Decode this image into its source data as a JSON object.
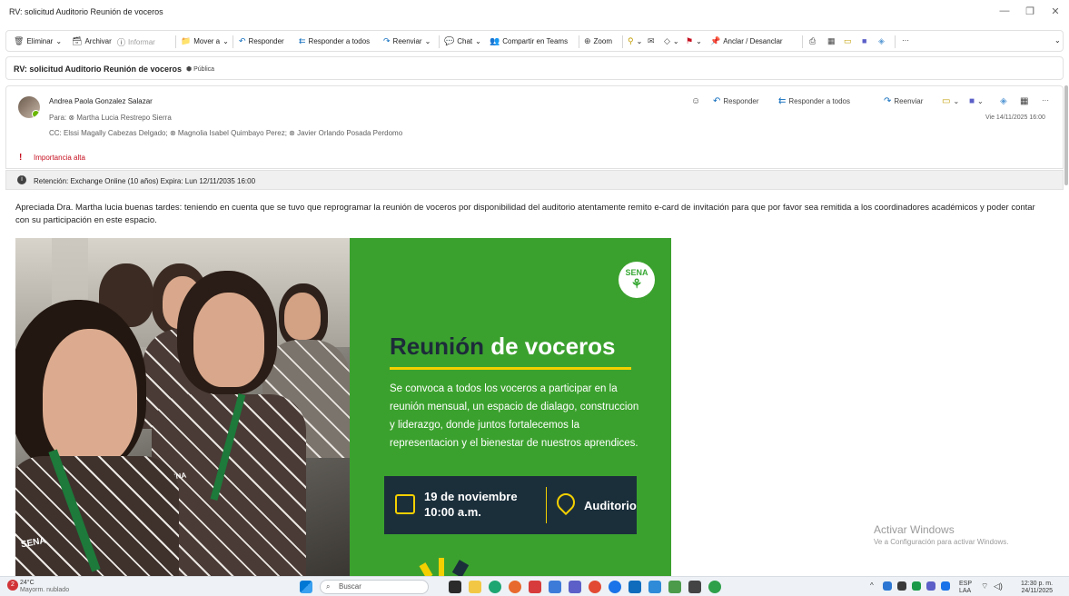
{
  "window": {
    "title": "RV: solicitud Auditorio Reunión de voceros",
    "minimize_glyph": "—",
    "maximize_glyph": "❐",
    "close_glyph": "✕"
  },
  "ribbon": {
    "delete_label": "Eliminar",
    "archive_label": "Archivar",
    "report_label": "Informar",
    "move_label": "Mover a",
    "reply_label": "Responder",
    "reply_all_label": "Responder a todos",
    "forward_label": "Reenviar",
    "chat_label": "Chat",
    "share_teams_label": "Compartir en Teams",
    "zoom_label": "Zoom",
    "pin_label": "Anclar / Desanclar",
    "more_label": "···"
  },
  "message": {
    "subject": "RV: solicitud Auditorio  Reunión de voceros",
    "sensitivity_badge": "Pública",
    "sender": "Andrea Paola Gonzalez Salazar",
    "to_line": "Para:  ⊗ Martha Lucia Restrepo Sierra",
    "cc_line": "CC:  Elssi Magally Cabezas Delgado;  ⊗ Magnolia Isabel Quimbayo Perez;  ⊗ Javier Orlando Posada Perdomo",
    "importance": "Importancia alta",
    "date": "Vie 14/11/2025 16:00",
    "retention": "Retención: Exchange Online (10 años) Expira: Lun 12/11/2035 16:00",
    "actions": {
      "reply": "Responder",
      "reply_all": "Responder a todos",
      "forward": "Reenviar",
      "more": "···"
    },
    "body": "Apreciada Dra. Martha lucia buenas tardes:  teniendo en cuenta que se tuvo que reprogramar la reunión de voceros por disponibilidad del auditorio atentamente remito e-card de invitación para que por favor sea remitida a los coordinadores académicos y poder contar con su participación en este espacio."
  },
  "ecard": {
    "logo_text": "SENA",
    "shirt_brand": "SENA",
    "title_part1": "Reunión",
    "title_part2": "de voceros",
    "description": "Se convoca a todos los voceros a participar en la reunión mensual, un espacio de dialago, construccion y liderazgo, donde juntos fortalecemos la representacion y el bienestar de nuestros aprendices.",
    "date_line1": "19 de noviembre",
    "date_line2": "10:00 a.m.",
    "place": "Auditorio",
    "colors": {
      "green": "#3ba12e",
      "navy": "#1b2f3b",
      "yellow": "#f4d000"
    }
  },
  "watermark": {
    "title": "Activar Windows",
    "subtitle": "Ve a Configuración para activar Windows."
  },
  "taskbar": {
    "weather_temp": "24°C",
    "weather_desc": "Mayorm. nublado",
    "weather_badge": "2",
    "search_placeholder": "Buscar",
    "lang_top": "ESP",
    "lang_bottom": "LAA",
    "time": "12:30 p. m.",
    "date": "24/11/2025"
  }
}
